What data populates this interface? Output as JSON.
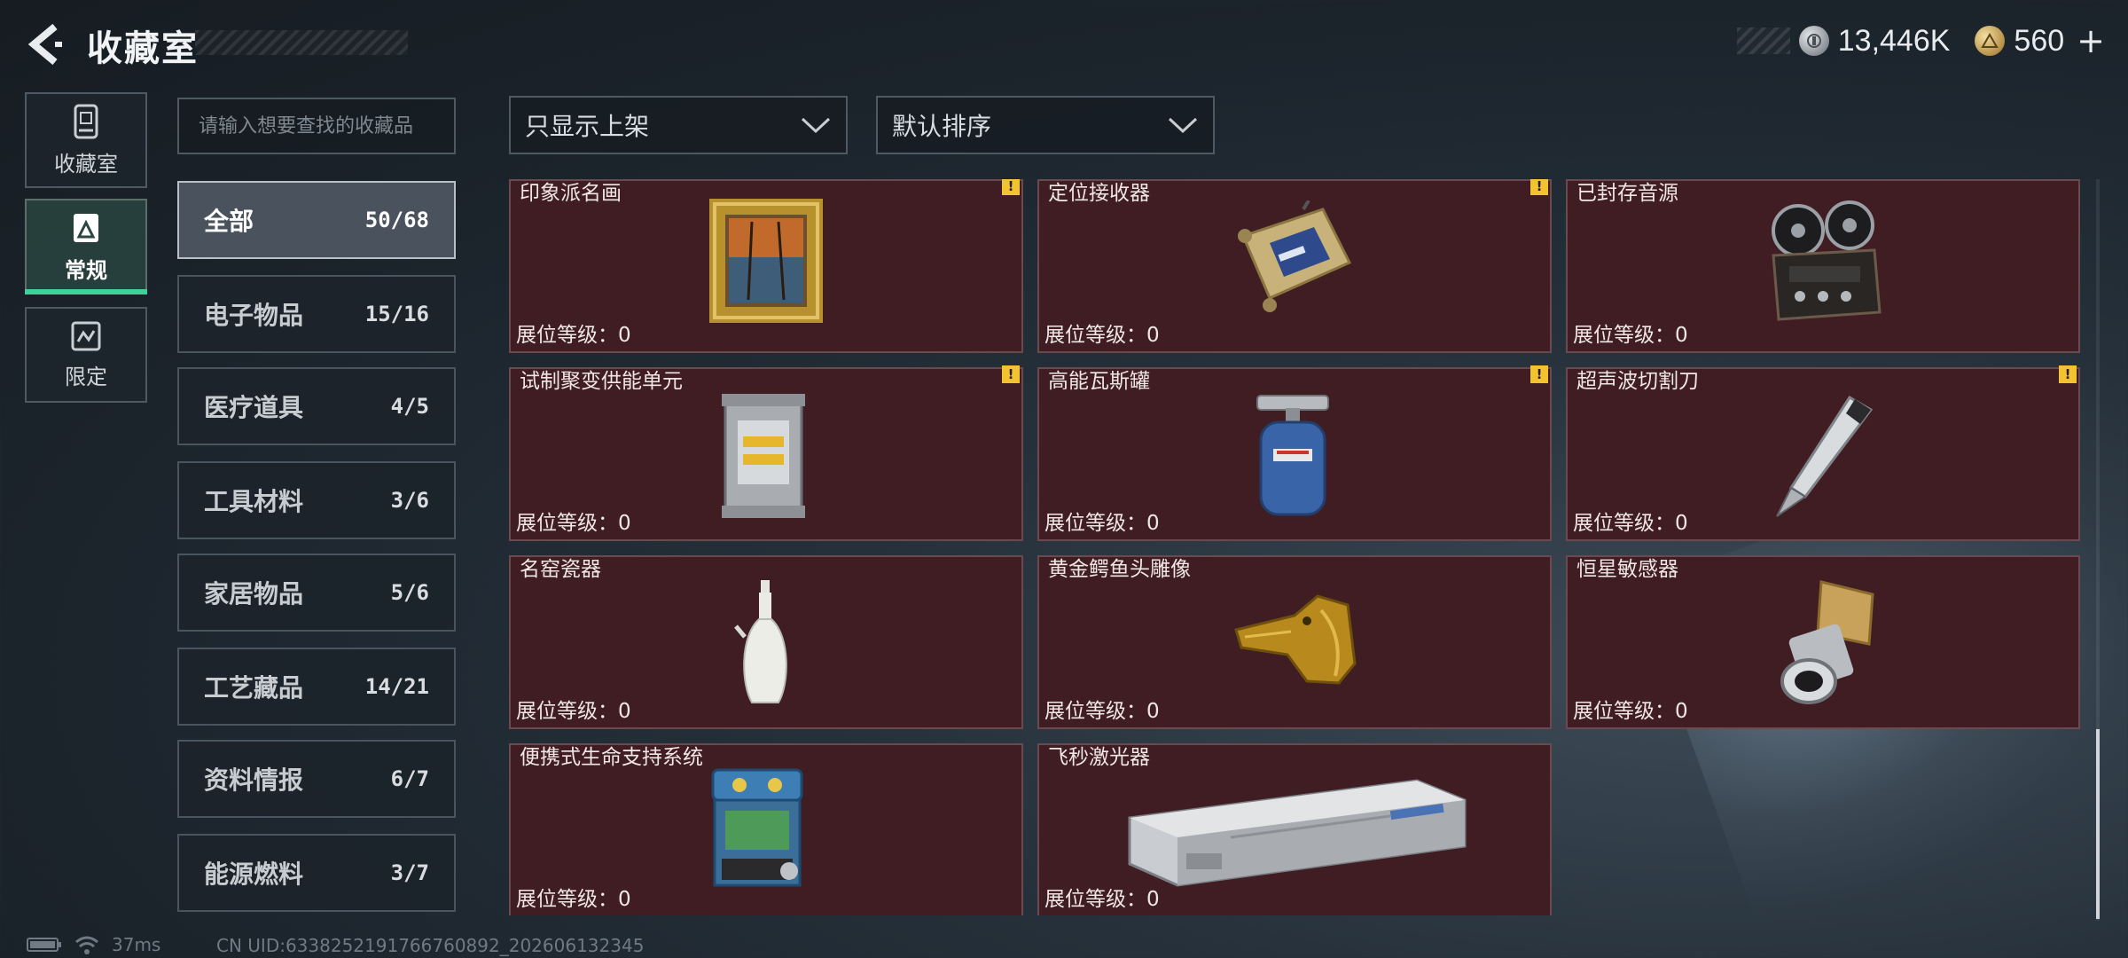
{
  "header": {
    "title": "收藏室",
    "currencies": [
      {
        "icon": "silver-coin-icon",
        "value": "13,446K"
      },
      {
        "icon": "gold-coin-icon",
        "value": "560"
      }
    ],
    "plus_label": "+"
  },
  "mode_tabs": [
    {
      "label": "收藏室",
      "icon": "collection-room-icon",
      "active": false
    },
    {
      "label": "常规",
      "icon": "regular-icon",
      "active": true
    },
    {
      "label": "限定",
      "icon": "limited-icon",
      "active": false
    }
  ],
  "search": {
    "placeholder": "请输入想要查找的收藏品",
    "value": ""
  },
  "categories": [
    {
      "name": "全部",
      "count": "50/68",
      "active": true
    },
    {
      "name": "电子物品",
      "count": "15/16"
    },
    {
      "name": "医疗道具",
      "count": "4/5"
    },
    {
      "name": "工具材料",
      "count": "3/6"
    },
    {
      "name": "家居物品",
      "count": "5/6"
    },
    {
      "name": "工艺藏品",
      "count": "14/21"
    },
    {
      "name": "资料情报",
      "count": "6/7"
    },
    {
      "name": "能源燃料",
      "count": "3/7"
    }
  ],
  "filters": {
    "display_filter": "只显示上架",
    "sort_order": "默认排序"
  },
  "items": [
    {
      "name": "印象派名画",
      "level": "展位等级：0",
      "warning": true,
      "icon": "painting-icon"
    },
    {
      "name": "定位接收器",
      "level": "展位等级：0",
      "warning": true,
      "icon": "locator-receiver-icon"
    },
    {
      "name": "已封存音源",
      "level": "展位等级：0",
      "warning": false,
      "icon": "reel-recorder-icon"
    },
    {
      "name": "试制聚变供能单元",
      "level": "展位等级：0",
      "warning": true,
      "icon": "fusion-unit-icon"
    },
    {
      "name": "高能瓦斯罐",
      "level": "展位等级：0",
      "warning": true,
      "icon": "gas-tank-icon"
    },
    {
      "name": "超声波切割刀",
      "level": "展位等级：0",
      "warning": true,
      "icon": "ultrasonic-cutter-icon"
    },
    {
      "name": "名窑瓷器",
      "level": "展位等级：0",
      "warning": false,
      "icon": "porcelain-vase-icon"
    },
    {
      "name": "黄金鳄鱼头雕像",
      "level": "展位等级：0",
      "warning": false,
      "icon": "gold-crocodile-icon"
    },
    {
      "name": "恒星敏感器",
      "level": "展位等级：0",
      "warning": false,
      "icon": "star-sensor-icon"
    },
    {
      "name": "便携式生命支持系统",
      "level": "展位等级：0",
      "warning": false,
      "icon": "life-support-icon"
    },
    {
      "name": "飞秒激光器",
      "level": "展位等级：0",
      "warning": false,
      "icon": "femtosecond-laser-icon"
    }
  ],
  "status": {
    "ping": "37ms",
    "uid": "CN UID:6338252191766760892_202606132345"
  },
  "colors": {
    "card_bg": "#3f1d22",
    "card_border": "#6b4a4f",
    "active_tab_accent": "#3fd19a",
    "warning": "#f2c230"
  }
}
